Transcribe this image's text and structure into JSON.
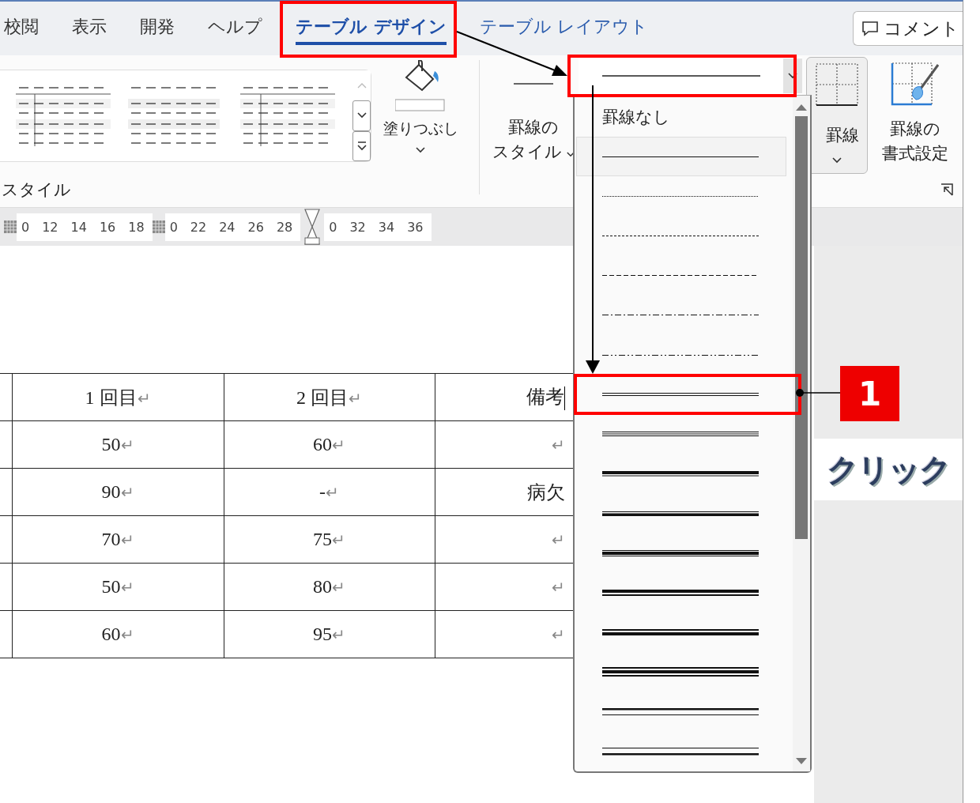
{
  "tabs": [
    {
      "label": "校閲",
      "kind": "standard",
      "selected": false
    },
    {
      "label": "表示",
      "kind": "standard",
      "selected": false
    },
    {
      "label": "開発",
      "kind": "standard",
      "selected": false
    },
    {
      "label": "ヘルプ",
      "kind": "standard",
      "selected": false
    },
    {
      "label": "テーブル デザイン",
      "kind": "contextual",
      "selected": true
    },
    {
      "label": "テーブル レイアウト",
      "kind": "contextual",
      "selected": false
    }
  ],
  "comment_button": {
    "label": "コメント"
  },
  "ribbon": {
    "styles_group_label": "スタイル",
    "shading_button": {
      "label": "塗りつぶし"
    },
    "border_styles_button": {
      "label_lines": [
        "罫線の",
        "スタイル"
      ]
    },
    "pen_style": {
      "kind": "solid"
    },
    "borders_button": {
      "label": "罫線"
    },
    "border_painter_button": {
      "label_lines": [
        "罫線の",
        "書式設定"
      ]
    }
  },
  "ruler": [
    "0",
    "12",
    "14",
    "16",
    "18",
    "0",
    "22",
    "24",
    "26",
    "28",
    "0",
    "32",
    "34",
    "36"
  ],
  "table": {
    "header": [
      {
        "text": "1 回目",
        "mark": "↵"
      },
      {
        "text": "2 回目",
        "mark": "↵"
      },
      {
        "text": "備考"
      }
    ],
    "rows": [
      [
        {
          "text": "50",
          "mark": "↵"
        },
        {
          "text": "60",
          "mark": "↵"
        },
        {
          "mark": "↵"
        }
      ],
      [
        {
          "text": "90",
          "mark": "↵"
        },
        {
          "text": "-",
          "mark": "↵"
        },
        {
          "text": "病欠"
        }
      ],
      [
        {
          "text": "70",
          "mark": "↵"
        },
        {
          "text": "75",
          "mark": "↵"
        },
        {
          "mark": "↵"
        }
      ],
      [
        {
          "text": "50",
          "mark": "↵"
        },
        {
          "text": "80",
          "mark": "↵"
        },
        {
          "mark": "↵"
        }
      ],
      [
        {
          "text": "60",
          "mark": "↵"
        },
        {
          "text": "95",
          "mark": "↵"
        },
        {
          "mark": "↵"
        }
      ]
    ]
  },
  "line_style_menu": {
    "options": [
      {
        "kind": "none",
        "label": "罫線なし",
        "selected": false
      },
      {
        "kind": "solid",
        "selected": true
      },
      {
        "kind": "dotted",
        "selected": false
      },
      {
        "kind": "dashed",
        "selected": false
      },
      {
        "kind": "longdash",
        "selected": false
      },
      {
        "kind": "dashdot",
        "selected": false
      },
      {
        "kind": "dashdotdot",
        "selected": false
      },
      {
        "kind": "double",
        "selected": false
      },
      {
        "kind": "triple",
        "selected": false
      },
      {
        "kind": "thickthin",
        "selected": false
      },
      {
        "kind": "thinthick",
        "selected": false
      },
      {
        "kind": "thinthickthin",
        "selected": false
      },
      {
        "kind": "thickthinmed",
        "selected": false
      },
      {
        "kind": "thinthickmed",
        "selected": false
      },
      {
        "kind": "thinthickthinmed",
        "selected": false
      },
      {
        "kind": "thickthinwide",
        "selected": false
      },
      {
        "kind": "thinthickwide",
        "selected": false
      }
    ]
  },
  "annotations": {
    "badge": "1",
    "callout": "クリック"
  }
}
